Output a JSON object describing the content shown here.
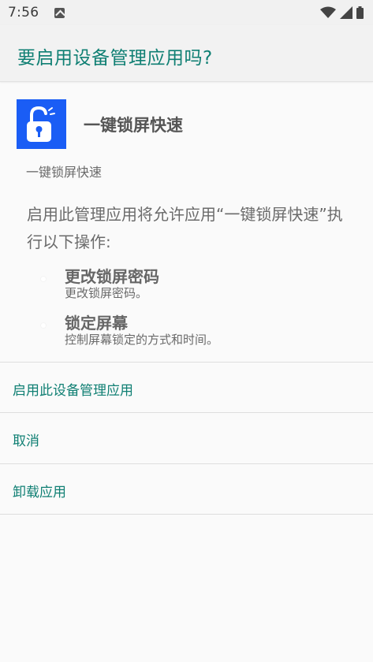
{
  "status_bar": {
    "time": "7:56",
    "icons": [
      "notification-a-icon",
      "wifi-icon",
      "signal-icon",
      "battery-icon"
    ]
  },
  "dialog": {
    "title": "要启用设备管理应用吗?",
    "app": {
      "icon": "unlock-icon",
      "name": "一键锁屏快速",
      "subname": "一键锁屏快速"
    },
    "description": "启用此管理应用将允许应用“一键锁屏快速”执行以下操作:",
    "permissions": [
      {
        "title": "更改锁屏密码",
        "desc": "更改锁屏密码。"
      },
      {
        "title": "锁定屏幕",
        "desc": "控制屏幕锁定的方式和时间。"
      }
    ],
    "actions": {
      "activate": "启用此设备管理应用",
      "cancel": "取消",
      "uninstall": "卸载应用"
    }
  },
  "colors": {
    "accent": "#0f7f73",
    "app_icon_bg": "#1a5df5",
    "background": "#fafafa"
  }
}
